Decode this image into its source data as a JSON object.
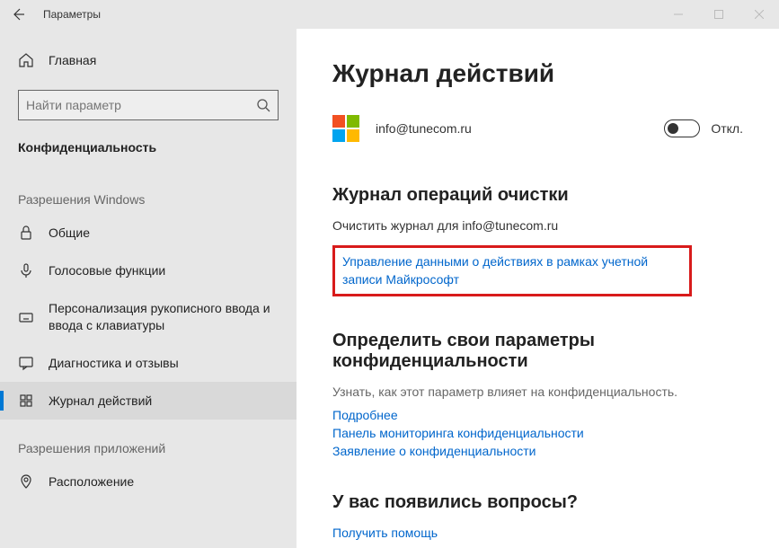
{
  "titlebar": {
    "title": "Параметры"
  },
  "sidebar": {
    "home": "Главная",
    "search_placeholder": "Найти параметр",
    "current_section": "Конфиденциальность",
    "group1_header": "Разрешения Windows",
    "items": [
      {
        "label": "Общие"
      },
      {
        "label": "Голосовые функции"
      },
      {
        "label": "Персонализация рукописного ввода и ввода с клавиатуры"
      },
      {
        "label": "Диагностика и отзывы"
      },
      {
        "label": "Журнал действий"
      }
    ],
    "group2_header": "Разрешения приложений",
    "items2": [
      {
        "label": "Расположение"
      }
    ]
  },
  "main": {
    "page_title": "Журнал действий",
    "account_email": "info@tunecom.ru",
    "toggle_label": "Откл.",
    "clear_heading": "Журнал операций очистки",
    "clear_text": "Очистить журнал для info@tunecom.ru",
    "ms_link": "Управление данными о действиях в рамках учетной записи Майкрософт",
    "privacy_heading": "Определить свои параметры конфиденциальности",
    "privacy_text": "Узнать, как этот параметр влияет на конфиденциальность.",
    "link_more": "Подробнее",
    "link_dashboard": "Панель мониторинга конфиденциальности",
    "link_statement": "Заявление о конфиденциальности",
    "questions_heading": "У вас появились вопросы?",
    "link_help": "Получить помощь"
  }
}
